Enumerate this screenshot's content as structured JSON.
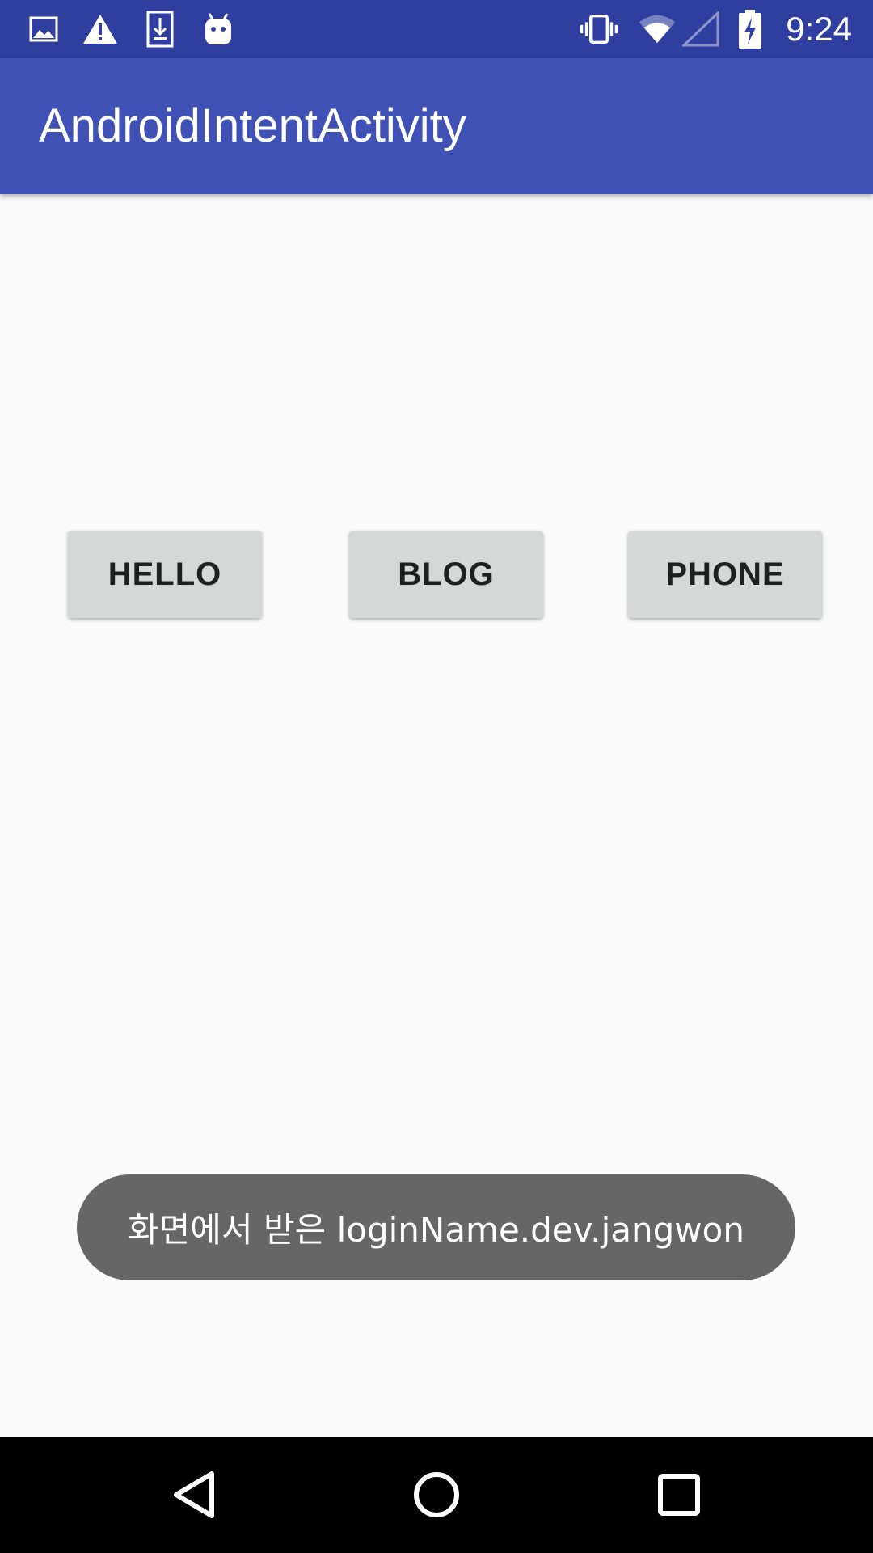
{
  "status_bar": {
    "time": "9:24",
    "background": "#303f9f",
    "icons_left": [
      "gallery-icon",
      "warning-icon",
      "download-icon",
      "android-icon"
    ],
    "icons_right": [
      "vibrate-icon",
      "wifi-icon",
      "cell-signal-icon",
      "battery-charging-icon"
    ]
  },
  "app_bar": {
    "title": "AndroidIntentActivity",
    "background": "#3f51b5"
  },
  "buttons": {
    "hello": "HELLO",
    "blog": "BLOG",
    "phone": "PHONE"
  },
  "toast": {
    "message": "화면에서 받은 loginName.dev.jangwon"
  },
  "nav_bar": {
    "icons": [
      "back-icon",
      "home-icon",
      "recents-icon"
    ]
  }
}
